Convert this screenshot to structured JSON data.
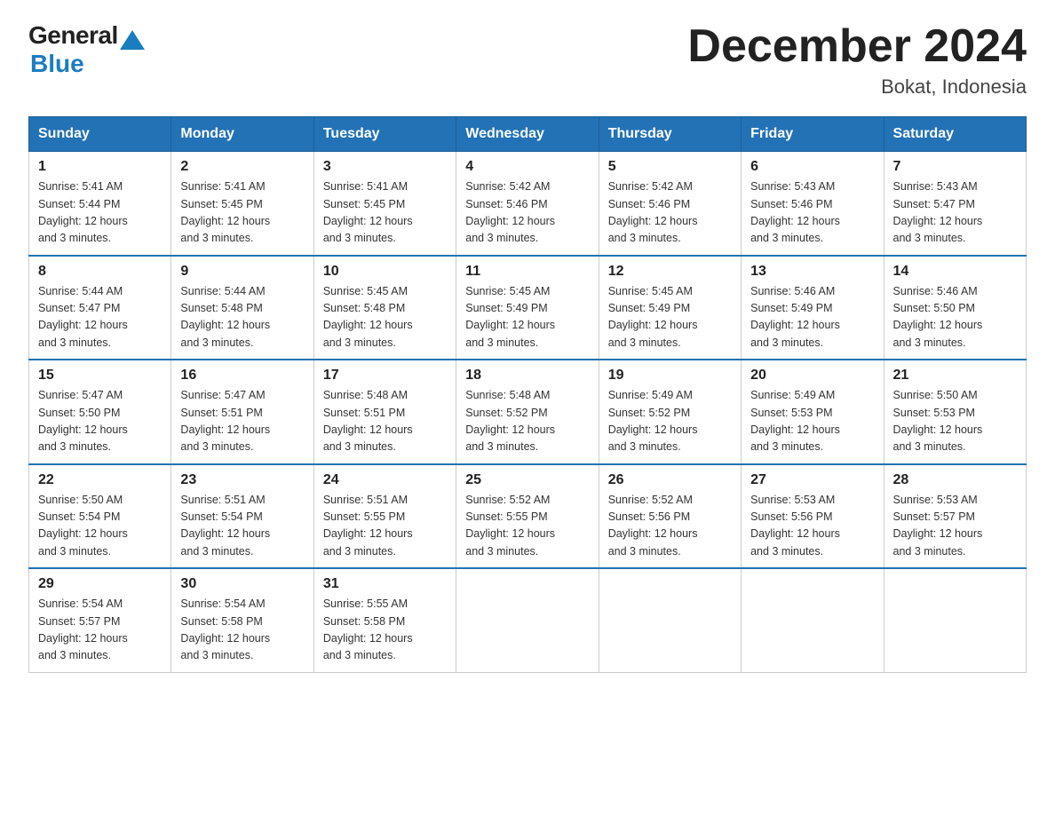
{
  "logo": {
    "text_general": "General",
    "text_blue": "Blue"
  },
  "title": "December 2024",
  "subtitle": "Bokat, Indonesia",
  "days_of_week": [
    "Sunday",
    "Monday",
    "Tuesday",
    "Wednesday",
    "Thursday",
    "Friday",
    "Saturday"
  ],
  "weeks": [
    [
      {
        "day": "1",
        "sunrise": "5:41 AM",
        "sunset": "5:44 PM",
        "daylight": "12 hours and 3 minutes."
      },
      {
        "day": "2",
        "sunrise": "5:41 AM",
        "sunset": "5:45 PM",
        "daylight": "12 hours and 3 minutes."
      },
      {
        "day": "3",
        "sunrise": "5:41 AM",
        "sunset": "5:45 PM",
        "daylight": "12 hours and 3 minutes."
      },
      {
        "day": "4",
        "sunrise": "5:42 AM",
        "sunset": "5:46 PM",
        "daylight": "12 hours and 3 minutes."
      },
      {
        "day": "5",
        "sunrise": "5:42 AM",
        "sunset": "5:46 PM",
        "daylight": "12 hours and 3 minutes."
      },
      {
        "day": "6",
        "sunrise": "5:43 AM",
        "sunset": "5:46 PM",
        "daylight": "12 hours and 3 minutes."
      },
      {
        "day": "7",
        "sunrise": "5:43 AM",
        "sunset": "5:47 PM",
        "daylight": "12 hours and 3 minutes."
      }
    ],
    [
      {
        "day": "8",
        "sunrise": "5:44 AM",
        "sunset": "5:47 PM",
        "daylight": "12 hours and 3 minutes."
      },
      {
        "day": "9",
        "sunrise": "5:44 AM",
        "sunset": "5:48 PM",
        "daylight": "12 hours and 3 minutes."
      },
      {
        "day": "10",
        "sunrise": "5:45 AM",
        "sunset": "5:48 PM",
        "daylight": "12 hours and 3 minutes."
      },
      {
        "day": "11",
        "sunrise": "5:45 AM",
        "sunset": "5:49 PM",
        "daylight": "12 hours and 3 minutes."
      },
      {
        "day": "12",
        "sunrise": "5:45 AM",
        "sunset": "5:49 PM",
        "daylight": "12 hours and 3 minutes."
      },
      {
        "day": "13",
        "sunrise": "5:46 AM",
        "sunset": "5:49 PM",
        "daylight": "12 hours and 3 minutes."
      },
      {
        "day": "14",
        "sunrise": "5:46 AM",
        "sunset": "5:50 PM",
        "daylight": "12 hours and 3 minutes."
      }
    ],
    [
      {
        "day": "15",
        "sunrise": "5:47 AM",
        "sunset": "5:50 PM",
        "daylight": "12 hours and 3 minutes."
      },
      {
        "day": "16",
        "sunrise": "5:47 AM",
        "sunset": "5:51 PM",
        "daylight": "12 hours and 3 minutes."
      },
      {
        "day": "17",
        "sunrise": "5:48 AM",
        "sunset": "5:51 PM",
        "daylight": "12 hours and 3 minutes."
      },
      {
        "day": "18",
        "sunrise": "5:48 AM",
        "sunset": "5:52 PM",
        "daylight": "12 hours and 3 minutes."
      },
      {
        "day": "19",
        "sunrise": "5:49 AM",
        "sunset": "5:52 PM",
        "daylight": "12 hours and 3 minutes."
      },
      {
        "day": "20",
        "sunrise": "5:49 AM",
        "sunset": "5:53 PM",
        "daylight": "12 hours and 3 minutes."
      },
      {
        "day": "21",
        "sunrise": "5:50 AM",
        "sunset": "5:53 PM",
        "daylight": "12 hours and 3 minutes."
      }
    ],
    [
      {
        "day": "22",
        "sunrise": "5:50 AM",
        "sunset": "5:54 PM",
        "daylight": "12 hours and 3 minutes."
      },
      {
        "day": "23",
        "sunrise": "5:51 AM",
        "sunset": "5:54 PM",
        "daylight": "12 hours and 3 minutes."
      },
      {
        "day": "24",
        "sunrise": "5:51 AM",
        "sunset": "5:55 PM",
        "daylight": "12 hours and 3 minutes."
      },
      {
        "day": "25",
        "sunrise": "5:52 AM",
        "sunset": "5:55 PM",
        "daylight": "12 hours and 3 minutes."
      },
      {
        "day": "26",
        "sunrise": "5:52 AM",
        "sunset": "5:56 PM",
        "daylight": "12 hours and 3 minutes."
      },
      {
        "day": "27",
        "sunrise": "5:53 AM",
        "sunset": "5:56 PM",
        "daylight": "12 hours and 3 minutes."
      },
      {
        "day": "28",
        "sunrise": "5:53 AM",
        "sunset": "5:57 PM",
        "daylight": "12 hours and 3 minutes."
      }
    ],
    [
      {
        "day": "29",
        "sunrise": "5:54 AM",
        "sunset": "5:57 PM",
        "daylight": "12 hours and 3 minutes."
      },
      {
        "day": "30",
        "sunrise": "5:54 AM",
        "sunset": "5:58 PM",
        "daylight": "12 hours and 3 minutes."
      },
      {
        "day": "31",
        "sunrise": "5:55 AM",
        "sunset": "5:58 PM",
        "daylight": "12 hours and 3 minutes."
      },
      null,
      null,
      null,
      null
    ]
  ],
  "labels": {
    "sunrise": "Sunrise:",
    "sunset": "Sunset:",
    "daylight": "Daylight:"
  }
}
